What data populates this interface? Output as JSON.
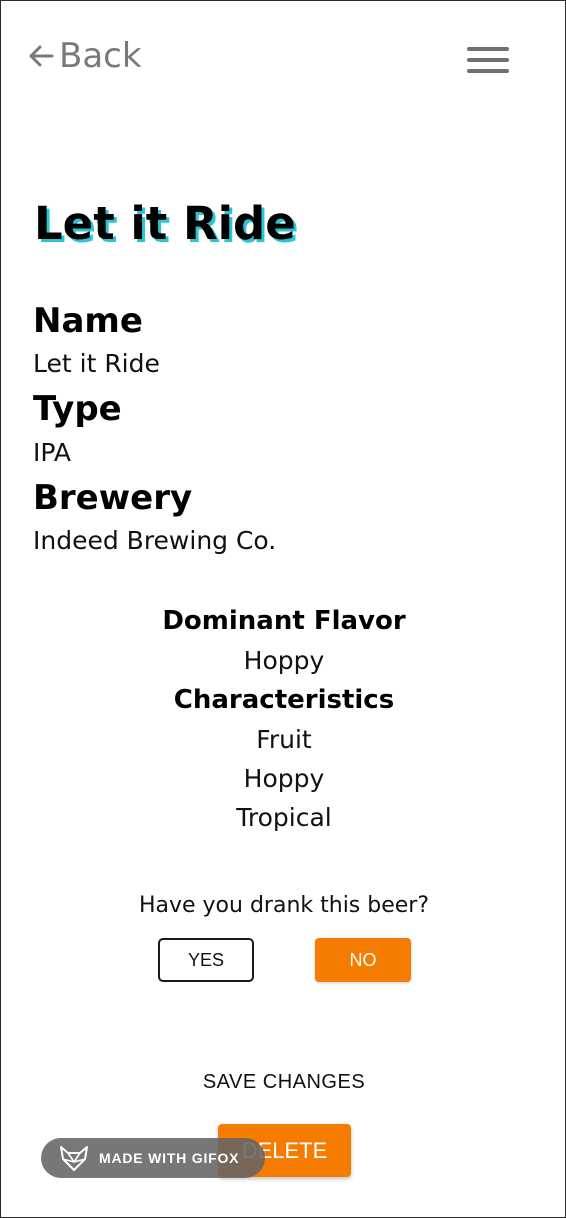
{
  "nav": {
    "back_label": "Back",
    "back_icon": "arrow-left-icon",
    "menu_icon": "hamburger-menu-icon"
  },
  "beer": {
    "title": "Let it Ride",
    "name_label": "Name",
    "name_value": "Let it Ride",
    "type_label": "Type",
    "type_value": "IPA",
    "brewery_label": "Brewery",
    "brewery_value": "Indeed Brewing Co."
  },
  "flavor": {
    "dominant_label": "Dominant Flavor",
    "dominant_value": "Hoppy",
    "characteristics_label": "Characteristics",
    "characteristics": [
      "Fruit",
      "Hoppy",
      "Tropical"
    ]
  },
  "drank": {
    "question": "Have you drank this beer?",
    "yes_label": "YES",
    "no_label": "NO",
    "selected": "NO"
  },
  "actions": {
    "save_label": "SAVE CHANGES",
    "delete_label": "DELETE"
  },
  "watermark": {
    "text": "MADE WITH GIFOX",
    "icon": "fox-logo-icon"
  },
  "colors": {
    "accent_orange": "#f57c00",
    "title_shadow_cyan": "#2bc4d6",
    "nav_gray": "#7a7a7a"
  }
}
